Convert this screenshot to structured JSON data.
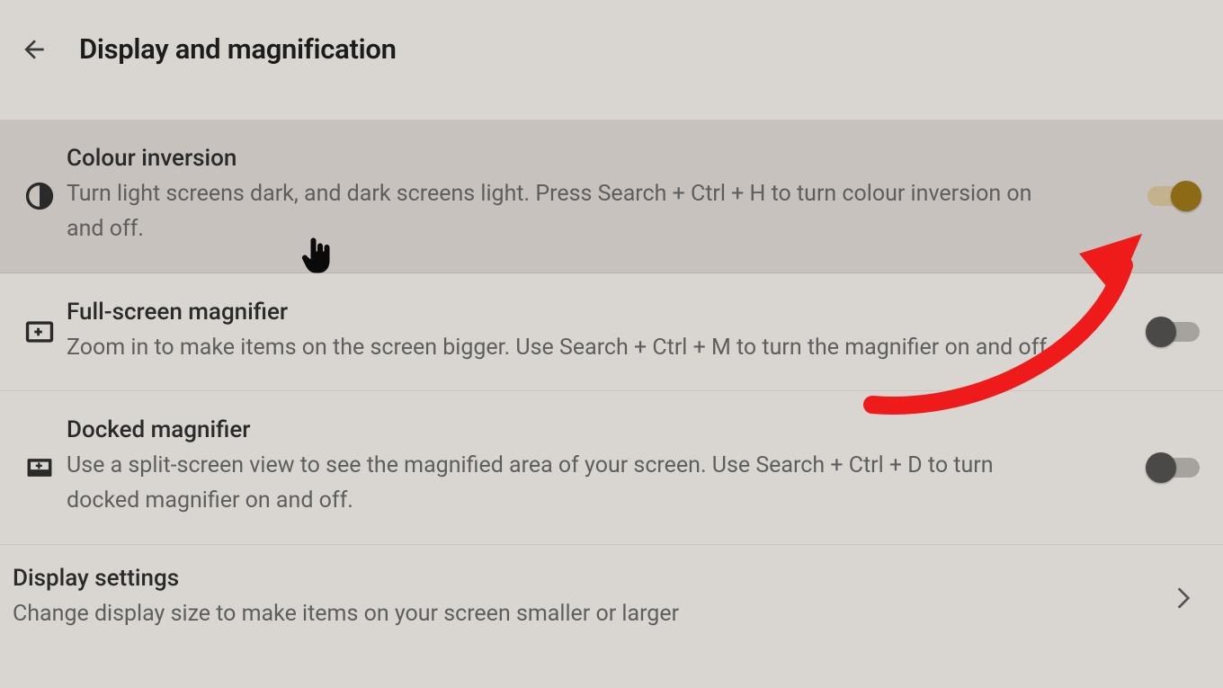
{
  "header": {
    "title": "Display and magnification"
  },
  "rows": {
    "colour_inversion": {
      "title": "Colour inversion",
      "desc": "Turn light screens dark, and dark screens light. Press Search + Ctrl + H to turn colour inversion on and off.",
      "toggle_on": true
    },
    "fullscreen_magnifier": {
      "title": "Full-screen magnifier",
      "desc": "Zoom in to make items on the screen bigger. Use Search + Ctrl + M to turn the magnifier on and off.",
      "toggle_on": false
    },
    "docked_magnifier": {
      "title": "Docked magnifier",
      "desc": "Use a split-screen view to see the magnified area of your screen. Use Search + Ctrl + D to turn docked magnifier on and off.",
      "toggle_on": false
    },
    "display_settings": {
      "title": "Display settings",
      "desc": "Change display size to make items on your screen smaller or larger"
    }
  }
}
